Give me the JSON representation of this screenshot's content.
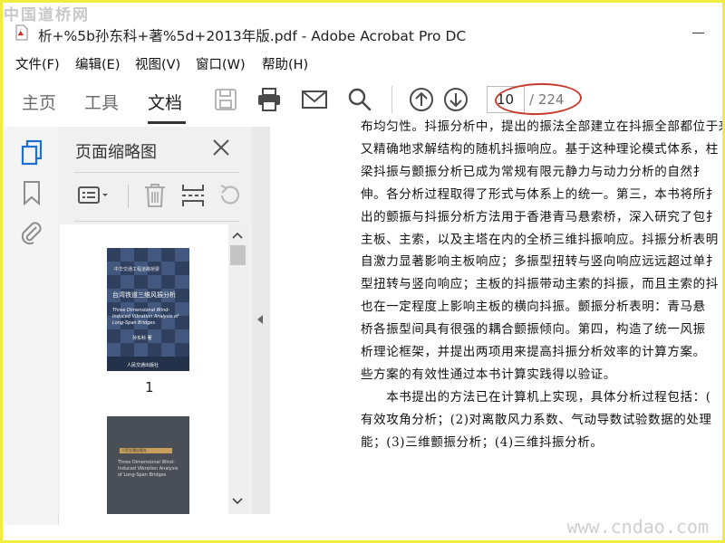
{
  "watermarks": {
    "top_left": "中国道桥网",
    "bottom_right": "www.cndao.com"
  },
  "window": {
    "title": "析+%5b孙东科+著%5d+2013年版.pdf - Adobe Acrobat Pro DC"
  },
  "menu": [
    "文件(F)",
    "编辑(E)",
    "视图(V)",
    "窗口(W)",
    "帮助(H)"
  ],
  "tabs": [
    {
      "label": "主页"
    },
    {
      "label": "工具"
    },
    {
      "label": "文档"
    }
  ],
  "toolbar_icons": [
    "save-icon",
    "print-icon",
    "email-icon",
    "search-icon",
    "page-up-icon",
    "page-down-icon"
  ],
  "page_nav": {
    "current": "10",
    "total": "/ 224"
  },
  "panel": {
    "title": "页面缩略图"
  },
  "thumbnails": [
    {
      "page_number": "1",
      "top_label": "中华交通工程道路桥梁",
      "title_cn": "台湾铁道三维风振分析",
      "title_en": "Three Dimensional Wind-Induced Vibration Analysis of Long-Span Bridges",
      "author": "孙东科 著",
      "publisher": "人民交通出版社"
    },
    {
      "page_number": "",
      "top_label": "人民交通出版社",
      "title_en": "Three Dimensional Wind-Induced Vibration Analysis of Long-Span Bridges"
    }
  ],
  "document_lines": [
    "布均匀性。抖振分析中，提出的振法全部建立在抖振全部都位于来向分",
    "又精确地求解结构的随机抖振响应。基于这种理论模式体系，柱",
    "梁抖振与颤振分析已成为常规有限元静力与动力分析的自然扌",
    "伸。各分析过程取得了形式与体系上的统一。第三，本书将所扌",
    "出的颤振与抖振分析方法用于香港青马悬索桥，深入研究了包扌",
    "主板、主索，以及主塔在内的全桥三维抖振响应。抖振分析表明",
    "自激力显著影响主板响应；多振型扭转与竖向响应远远超过单扌",
    "型扭转与竖向响应；主板的抖振带动主索的抖振，而且主索的抖",
    "也在一定程度上影响主板的横向抖振。颤振分析表明：青马悬",
    "桥各振型间具有很强的耦合颤振倾向。第四，构造了统一风振",
    "析理论框架，并提出两项用来提高抖振分析效率的计算方案。",
    "些方案的有效性通过本书计算实践得以验证。",
    "　　本书提出的方法已在计算机上实现，具体分析过程包括：(",
    "有效攻角分析；(2)对离散风力系数、气动导数试验数据的处理",
    "能；(3)三维颤振分析；(4)三维抖振分析。"
  ],
  "colors": {
    "accent_blue": "#1f6fd1",
    "annotation_red": "#c83a2c",
    "frame_yellow": "#f2ec3f",
    "pdf_red": "#d8291d"
  }
}
